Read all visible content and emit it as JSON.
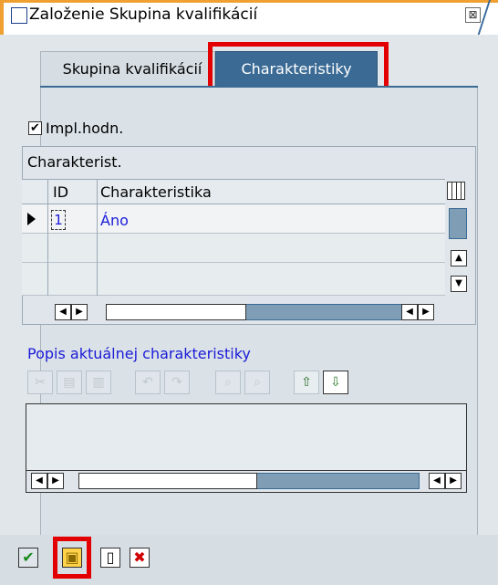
{
  "window": {
    "title": "Založenie Skupina kvalifikácií",
    "close_glyph": "⊠"
  },
  "tabs": [
    {
      "label": "Skupina kvalifikácií",
      "active": false
    },
    {
      "label": "Charakteristiky",
      "active": true
    }
  ],
  "checkbox": {
    "label": "Impl.hodn.",
    "checked": true,
    "glyph": "✔"
  },
  "grid": {
    "title": "Charakterist.",
    "columns": [
      "ID",
      "Charakteristika"
    ],
    "rows": [
      {
        "id": "1",
        "characteristic": "Áno"
      }
    ]
  },
  "description": {
    "title": "Popis aktuálnej charakteristiky",
    "toolbar_icons": [
      "cut-icon",
      "copy-icon",
      "paste-icon",
      "undo-icon",
      "redo-icon",
      "find-icon",
      "find-next-icon",
      "upload-icon",
      "download-icon"
    ]
  },
  "glyphs": {
    "left": "◀",
    "right": "▶",
    "up": "▲",
    "down": "▼",
    "cut": "✂",
    "copy": "▤",
    "paste": "▥",
    "undo": "↶",
    "redo": "↷",
    "find": "⌕",
    "find_next": "⌕",
    "upload": "⇧",
    "download": "⇩",
    "ok": "✔",
    "save": "▣",
    "new": "▯",
    "cancel": "✖"
  },
  "colors": {
    "active_tab": "#3b6b95",
    "highlight": "#e20000",
    "link_text": "#1a1ad8",
    "title_accent": "#f0a030"
  }
}
